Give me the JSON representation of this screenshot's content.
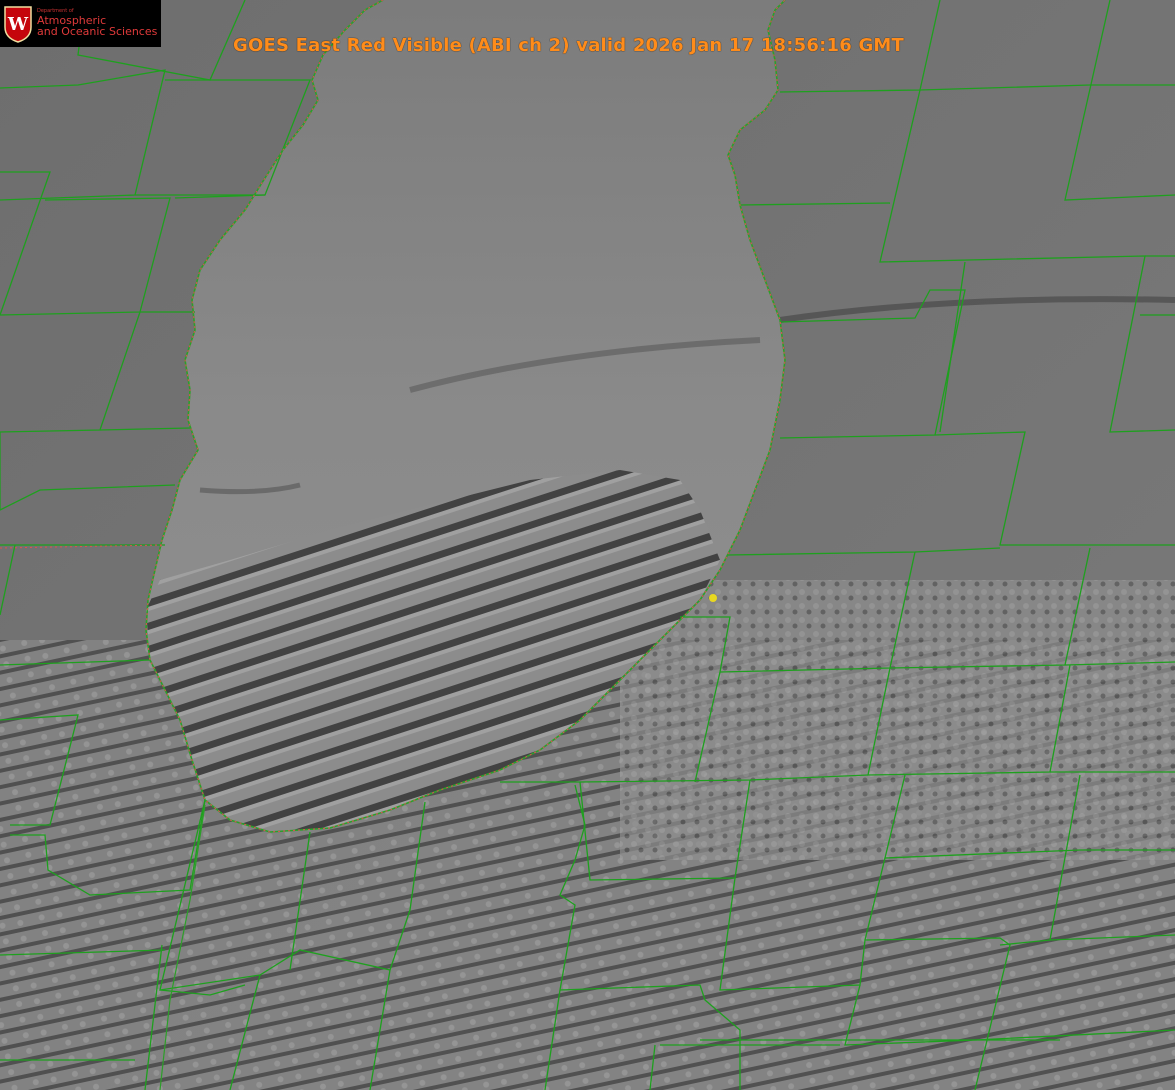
{
  "title": "GOES East Red Visible (ABI ch 2) valid 2026 Jan 17 18:56:16 GMT",
  "logo": {
    "department": "Department of",
    "line1": "Atmospheric",
    "line2": "and Oceanic Sciences",
    "seal_letter": "W"
  },
  "colors": {
    "county_lines": "#1ea01e",
    "shoreline": "#2aa02a",
    "shoreline_dots": "#e05050",
    "marker": "#e8d820",
    "title": "#ff8c1a",
    "logo_text": "#e03a3a"
  },
  "layers": [
    "visible-satellite-imagery",
    "county-boundaries",
    "lake-michigan-shoreline",
    "location-marker"
  ]
}
